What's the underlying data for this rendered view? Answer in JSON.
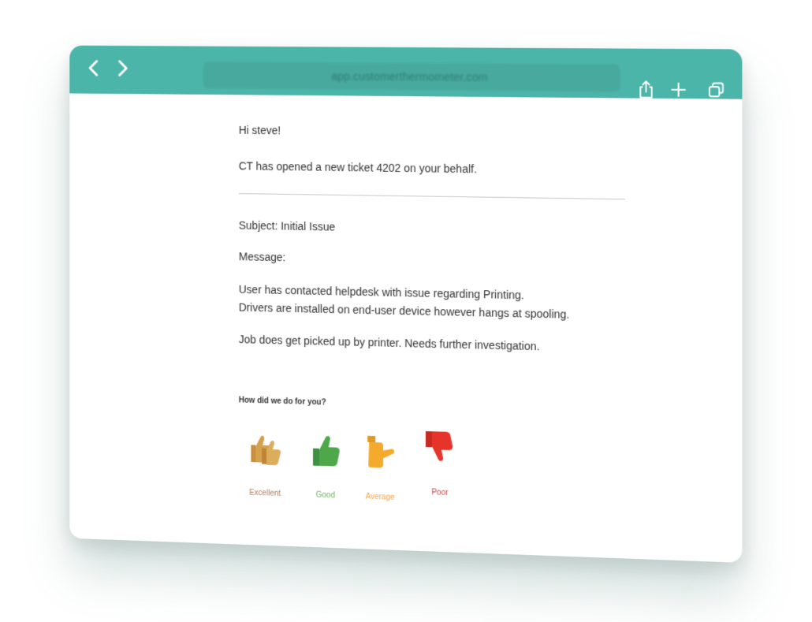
{
  "browser": {
    "url": "app.customerthermometer.com"
  },
  "email": {
    "greeting": "Hi steve!",
    "intro": "CT has opened a new ticket 4202 on your behalf.",
    "subject": "Subject: Initial Issue",
    "message_label": "Message:",
    "body_line1": "User has contacted helpdesk with issue regarding Printing.",
    "body_line2": "Drivers are installed on end-user device however hangs at spooling.",
    "body_line3": "Job does get picked up by printer. Needs further investigation."
  },
  "survey": {
    "question": "How did we do for you?",
    "options": [
      {
        "label": "Excellent",
        "color": "#d4a24c",
        "text_color": "#b07a58",
        "icon": "double-thumbs-up-icon"
      },
      {
        "label": "Good",
        "color": "#4ea84a",
        "text_color": "#6bb35c",
        "icon": "thumbs-up-icon"
      },
      {
        "label": "Average",
        "color": "#f4ab2d",
        "text_color": "#f0a545",
        "icon": "thumbs-sideways-icon"
      },
      {
        "label": "Poor",
        "color": "#e5342a",
        "text_color": "#c0484a",
        "icon": "thumbs-down-icon"
      }
    ]
  },
  "theme": {
    "toolbar_color": "#4cb5a9"
  }
}
